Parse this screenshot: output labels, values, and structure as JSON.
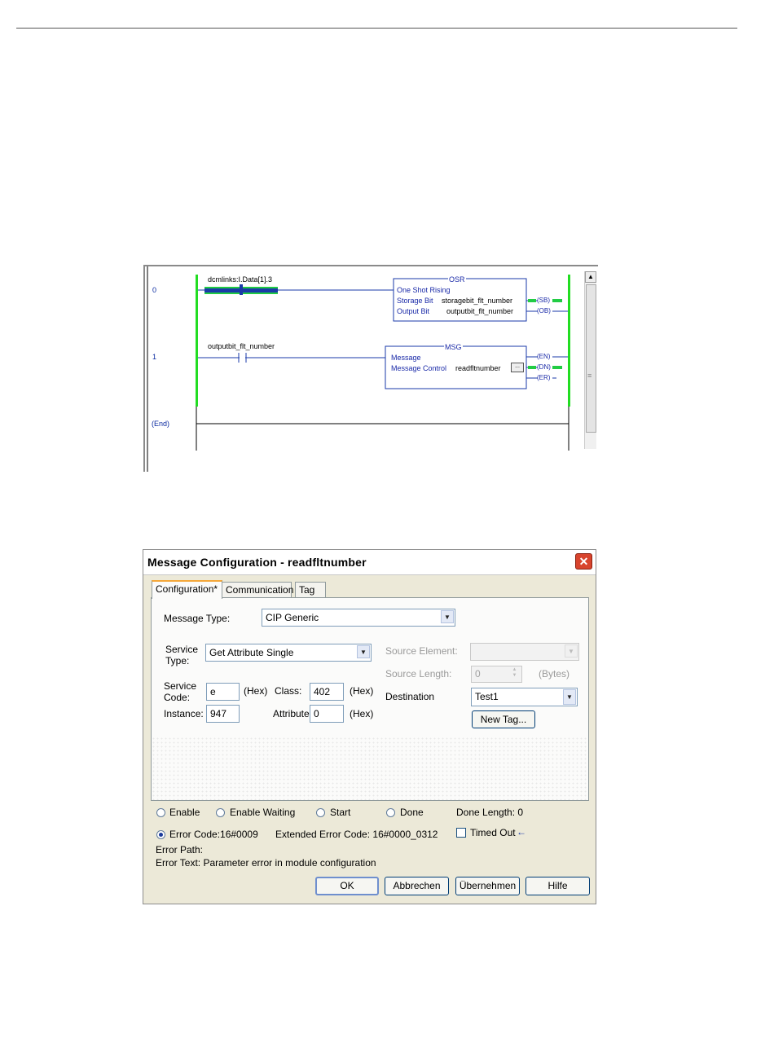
{
  "ladder": {
    "rungs": [
      {
        "number": "0"
      },
      {
        "number": "1"
      },
      {
        "number": "(End)"
      }
    ],
    "rung0": {
      "contact_tag": "dcmlinks:I.Data[1].3",
      "block_name": "OSR",
      "block_desc": "One Shot Rising",
      "storage_label": "Storage Bit",
      "storage_value": "storagebit_flt_number",
      "output_label": "Output Bit",
      "output_value": "outputbit_flt_number",
      "outputs": [
        "(SB)",
        "(OB)"
      ]
    },
    "rung1": {
      "contact_tag": "outputbit_flt_number",
      "block_name": "MSG",
      "block_desc": "Message",
      "control_label": "Message Control",
      "control_value": "readfltnumber",
      "browse_label": "...",
      "outputs": [
        "(EN)",
        "(DN)",
        "(ER)"
      ]
    },
    "scroll_up": "▲",
    "scroll_grip": "≡"
  },
  "dialog": {
    "title": "Message Configuration - readfltnumber",
    "close": "✕",
    "tabs": [
      "Configuration*",
      "Communication",
      "Tag"
    ],
    "message_type_label": "Message Type:",
    "message_type_value": "CIP Generic",
    "service_type_label_1": "Service",
    "service_type_label_2": "Type:",
    "service_type_value": "Get Attribute Single",
    "service_code_label_1": "Service",
    "service_code_label_2": "Code:",
    "service_code_value": "e",
    "hex": "(Hex)",
    "class_label": "Class:",
    "class_value": "402",
    "instance_label": "Instance:",
    "instance_value": "947",
    "attribute_label": "Attribute:",
    "attribute_value": "0",
    "source_element_label": "Source Element:",
    "source_length_label": "Source Length:",
    "source_length_value": "0",
    "bytes": "(Bytes)",
    "destination_label": "Destination",
    "destination_value": "Test1",
    "new_tag": "New Tag...",
    "status": {
      "enable": "Enable",
      "enable_waiting": "Enable Waiting",
      "start": "Start",
      "done": "Done",
      "done_length": "Done Length: 0",
      "error_code": "Error Code:16#0009",
      "extended_error": "Extended Error Code: 16#0000_0312",
      "timed_out": "Timed Out",
      "timed_out_arrow": "←",
      "error_path": "Error Path:",
      "error_text": "Error Text: Parameter error in module configuration"
    },
    "buttons": {
      "ok": "OK",
      "cancel": "Abbrechen",
      "apply": "Übernehmen",
      "help": "Hilfe"
    }
  }
}
